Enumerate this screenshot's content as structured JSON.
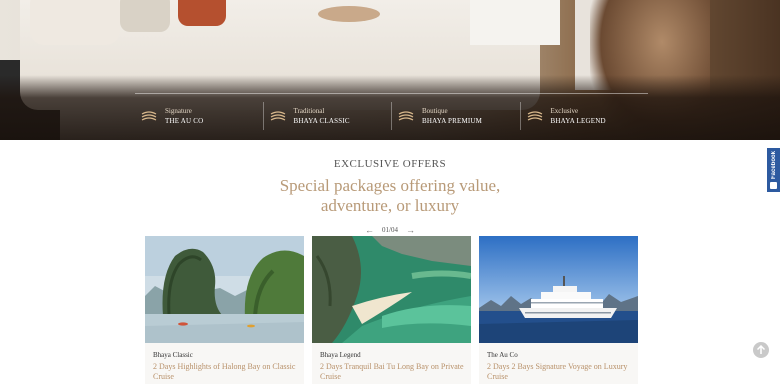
{
  "hero": {
    "categories": [
      {
        "type": "Signature",
        "name": "THE AU CO"
      },
      {
        "type": "Traditional",
        "name": "BHAYA CLASSIC"
      },
      {
        "type": "Boutique",
        "name": "BHAYA PREMIUM"
      },
      {
        "type": "Exclusive",
        "name": "BHAYA LEGEND"
      }
    ]
  },
  "offers": {
    "eyebrow": "EXCLUSIVE OFFERS",
    "headline_line1": "Special packages offering value,",
    "headline_line2": "adventure, or luxury",
    "pager": "01/04",
    "cards": [
      {
        "tag": "Bhaya Classic",
        "title": "2 Days Highlights of Halong Bay on Classic Cruise"
      },
      {
        "tag": "Bhaya Legend",
        "title": "2 Days Tranquil Bai Tu Long Bay on Private Cruise"
      },
      {
        "tag": "The Au Co",
        "title": "2 Days 2 Bays Signature Voyage on Luxury Cruise"
      }
    ]
  },
  "side": {
    "facebook_label": "Facebook"
  },
  "colors": {
    "accent_gold": "#b89a78",
    "facebook_blue": "#2d5aa0"
  }
}
